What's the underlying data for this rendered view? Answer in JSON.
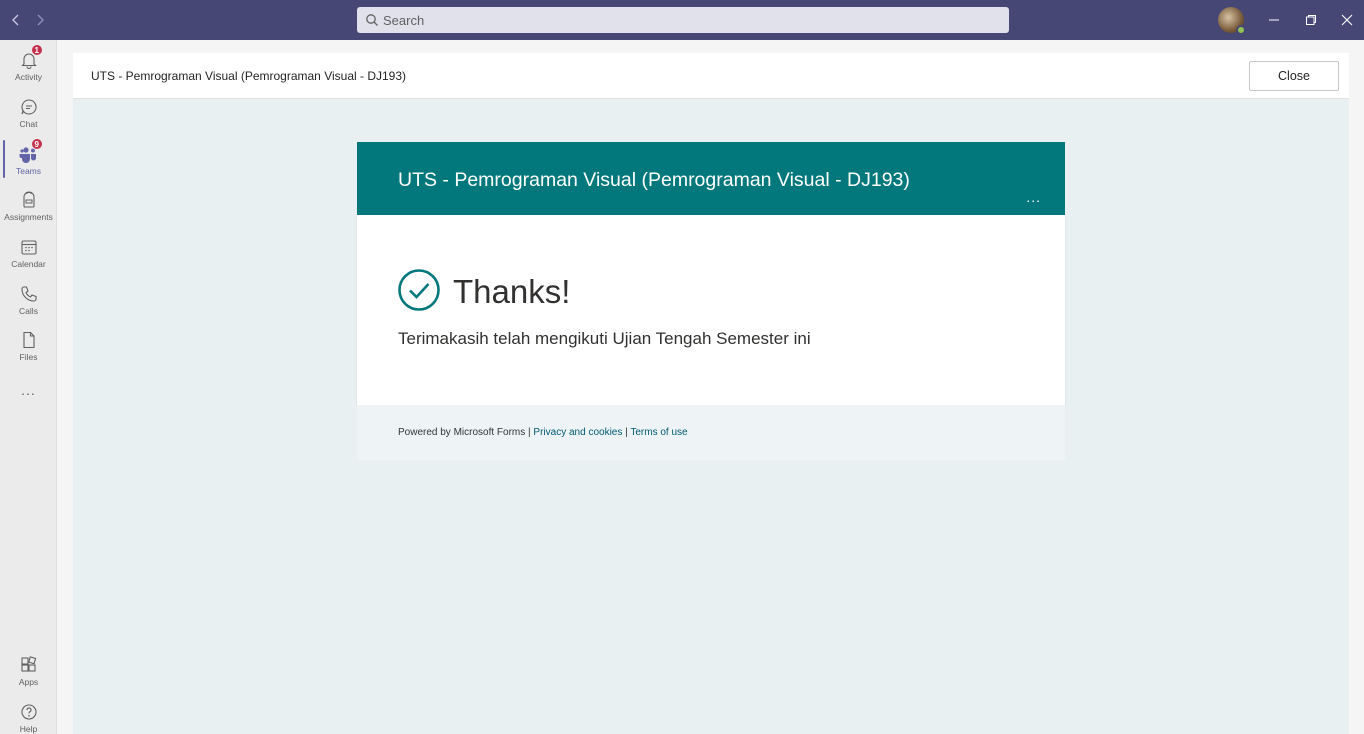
{
  "search": {
    "placeholder": "Search"
  },
  "rail": {
    "items": [
      {
        "label": "Activity",
        "badge": "1"
      },
      {
        "label": "Chat"
      },
      {
        "label": "Teams",
        "badge": "9"
      },
      {
        "label": "Assignments"
      },
      {
        "label": "Calendar"
      },
      {
        "label": "Calls"
      },
      {
        "label": "Files"
      }
    ],
    "more": "...",
    "bottom": [
      {
        "label": "Apps"
      },
      {
        "label": "Help"
      }
    ]
  },
  "panel": {
    "title": "UTS - Pemrograman Visual (Pemrograman Visual - DJ193)",
    "close_label": "Close"
  },
  "form": {
    "title": "UTS - Pemrograman Visual (Pemrograman Visual - DJ193)",
    "more": "...",
    "thanks": "Thanks!",
    "message": "Terimakasih telah mengikuti Ujian Tengah Semester ini",
    "footer": {
      "powered": "Powered by Microsoft Forms |",
      "privacy": "Privacy and cookies",
      "sep": "|",
      "terms": "Terms of use"
    }
  },
  "colors": {
    "titlebar": "#464775",
    "accent": "#6264a7",
    "form_header": "#03787c",
    "badge": "#c4314b"
  }
}
